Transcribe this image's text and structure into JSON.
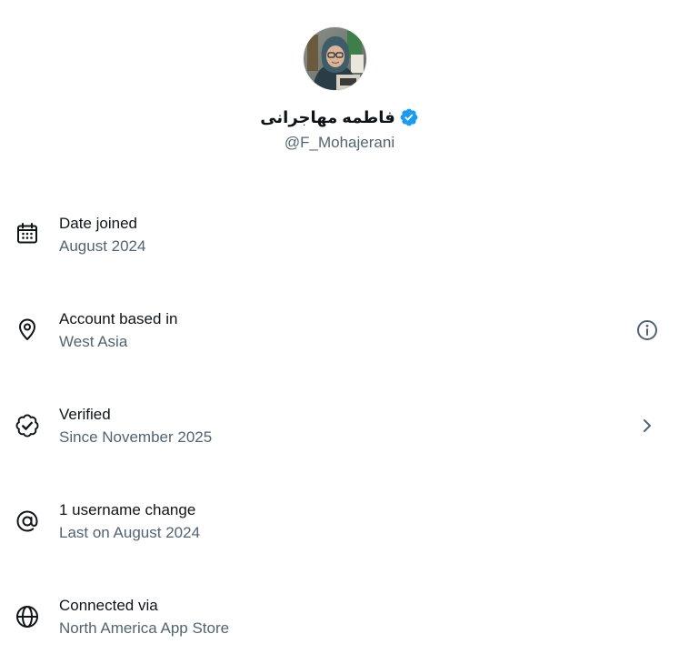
{
  "profile": {
    "display_name": "فاطمه مهاجرانی",
    "handle": "@F_Mohajerani",
    "verified_color": "#1d9bf0",
    "avatar_icon": "profile-photo"
  },
  "rows": [
    {
      "title": "Date joined",
      "subtitle": "August 2024",
      "icon": "calendar-icon"
    },
    {
      "title": "Account based in",
      "subtitle": "West Asia",
      "icon": "location-pin-icon",
      "trailing_icon": "info-icon"
    },
    {
      "title": "Verified",
      "subtitle": "Since November 2025",
      "icon": "verified-check-icon",
      "trailing_icon": "chevron-right-icon"
    },
    {
      "title": "1 username change",
      "subtitle": "Last on August 2024",
      "icon": "at-sign-icon"
    },
    {
      "title": "Connected via",
      "subtitle": "North America App Store",
      "icon": "globe-icon"
    }
  ],
  "colors": {
    "primary_text": "#0f1419",
    "secondary_text": "#536471",
    "accent": "#1d9bf0"
  }
}
